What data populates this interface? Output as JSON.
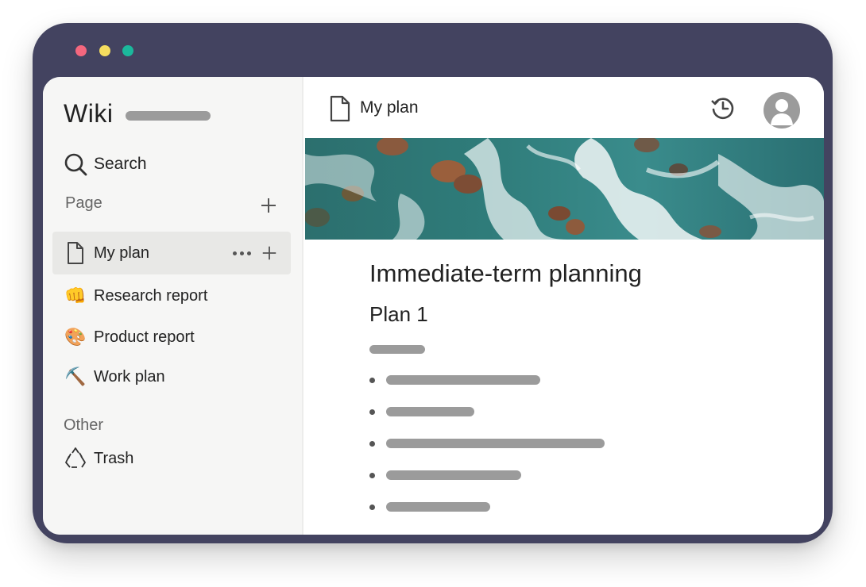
{
  "window": {
    "controls": [
      "close",
      "minimize",
      "zoom"
    ],
    "colors": {
      "frame": "#434360",
      "close": "#f4677e",
      "minimize": "#f5dd5f",
      "zoom": "#1bb89c"
    }
  },
  "sidebar": {
    "title": "Wiki",
    "search_label": "Search",
    "page_section_label": "Page",
    "pages": [
      {
        "label": "My plan",
        "icon": "document-icon",
        "active": true
      },
      {
        "label": "Research report",
        "icon": "fist-emoji",
        "emoji": "👊"
      },
      {
        "label": "Product report",
        "icon": "palette-emoji",
        "emoji": "🎨"
      },
      {
        "label": "Work plan",
        "icon": "pick-emoji",
        "emoji": "⛏️"
      }
    ],
    "other_section_label": "Other",
    "other_items": [
      {
        "label": "Trash",
        "icon": "recycle-icon"
      }
    ]
  },
  "main": {
    "page_title": "My plan",
    "heading": "Immediate-term planning",
    "subheading": "Plan 1"
  }
}
